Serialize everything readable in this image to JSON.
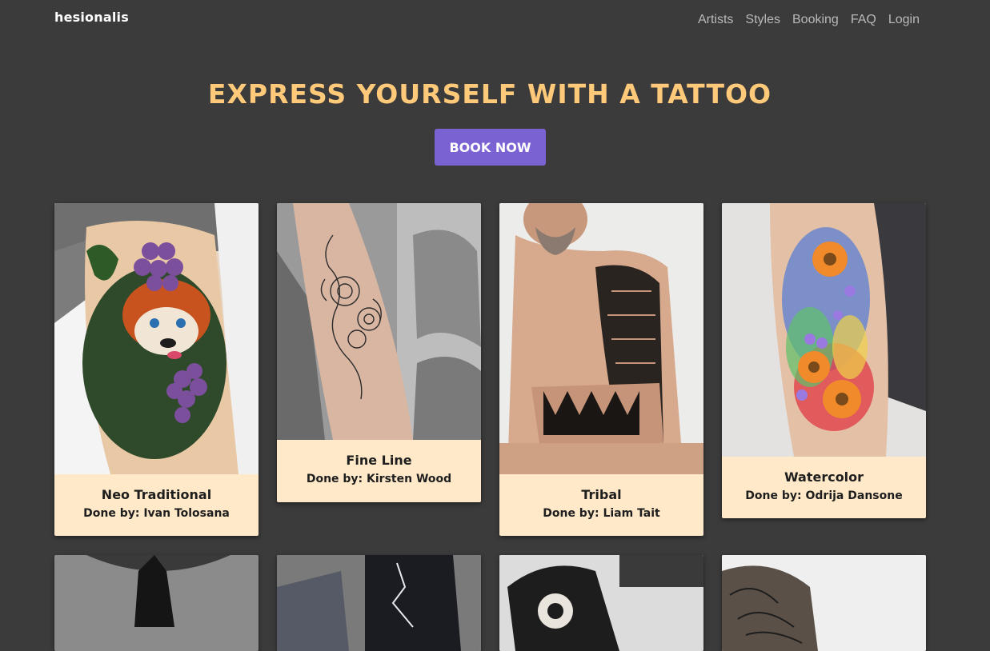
{
  "brand": {
    "name": "hesionalis"
  },
  "nav": {
    "items": [
      "Artists",
      "Styles",
      "Booking",
      "FAQ",
      "Login"
    ]
  },
  "hero": {
    "title": "EXPRESS YOURSELF WITH A TATTOO",
    "cta": "BOOK NOW"
  },
  "colors": {
    "background": "#3b3b3b",
    "accent": "#7b62d2",
    "title": "#ffc97a",
    "card": "#ffe9c9"
  },
  "gallery": {
    "done_by_label": "Done by:",
    "cards": [
      {
        "style": "Neo Traditional",
        "artist": "Ivan Tolosana",
        "image": "red panda with grapes tattoo on leg"
      },
      {
        "style": "Fine Line",
        "artist": "Kirsten Wood",
        "image": "snake and flower line tattoo on forearm"
      },
      {
        "style": "Tribal",
        "artist": "Liam Tait",
        "image": "tribal sleeve tattoo on arm"
      },
      {
        "style": "Watercolor",
        "artist": "Odrija Dansone",
        "image": "watercolor flower tattoo on forearm"
      }
    ]
  }
}
